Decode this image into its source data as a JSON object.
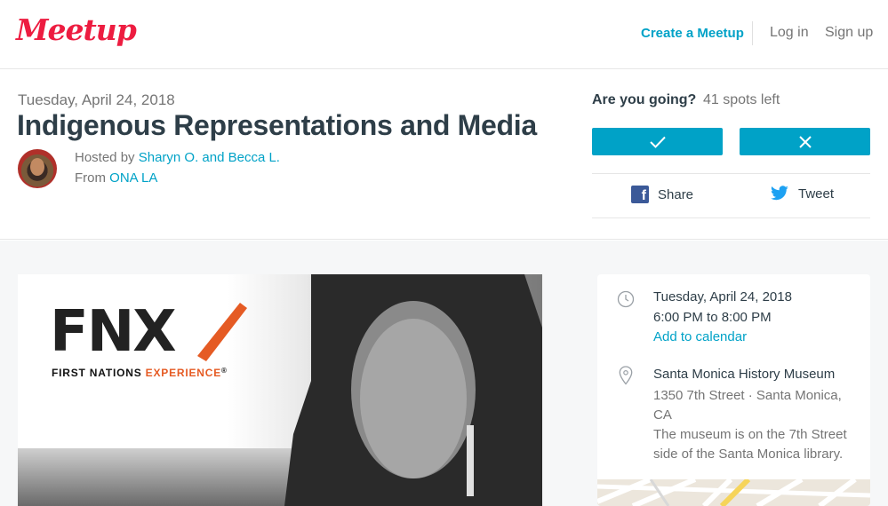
{
  "nav": {
    "logo": "Meetup",
    "create_label": "Create a Meetup",
    "login_label": "Log in",
    "signup_label": "Sign up"
  },
  "event": {
    "date": "Tuesday, April 24, 2018",
    "title": "Indigenous Representations and Media",
    "hosted_prefix": "Hosted by",
    "hosts": "Sharyn O. and Becca L.",
    "from_prefix": "From",
    "group": "ONA LA"
  },
  "rsvp": {
    "question": "Are you going?",
    "spots": "41 spots left",
    "yes_icon": "checkmark-icon",
    "no_icon": "x-icon",
    "share_label": "Share",
    "tweet_label": "Tweet"
  },
  "image": {
    "logo_text": "FNX",
    "subtitle_black": "FIRST NATIONS ",
    "subtitle_orange": "EXPERIENCE",
    "subtitle_mark": "®"
  },
  "details": {
    "date": "Tuesday, April 24, 2018",
    "time": "6:00 PM to 8:00 PM",
    "calendar_link": "Add to calendar",
    "venue": "Santa Monica History Museum",
    "address": "1350 7th Street · Santa Monica, CA",
    "note": "The museum is on the 7th Street side of the Santa Monica library."
  },
  "colors": {
    "brand": "#ed1c40",
    "accent": "#00a2c7",
    "facebook": "#3b5998",
    "twitter": "#1da1f2",
    "fnx_orange": "#e55b24"
  }
}
